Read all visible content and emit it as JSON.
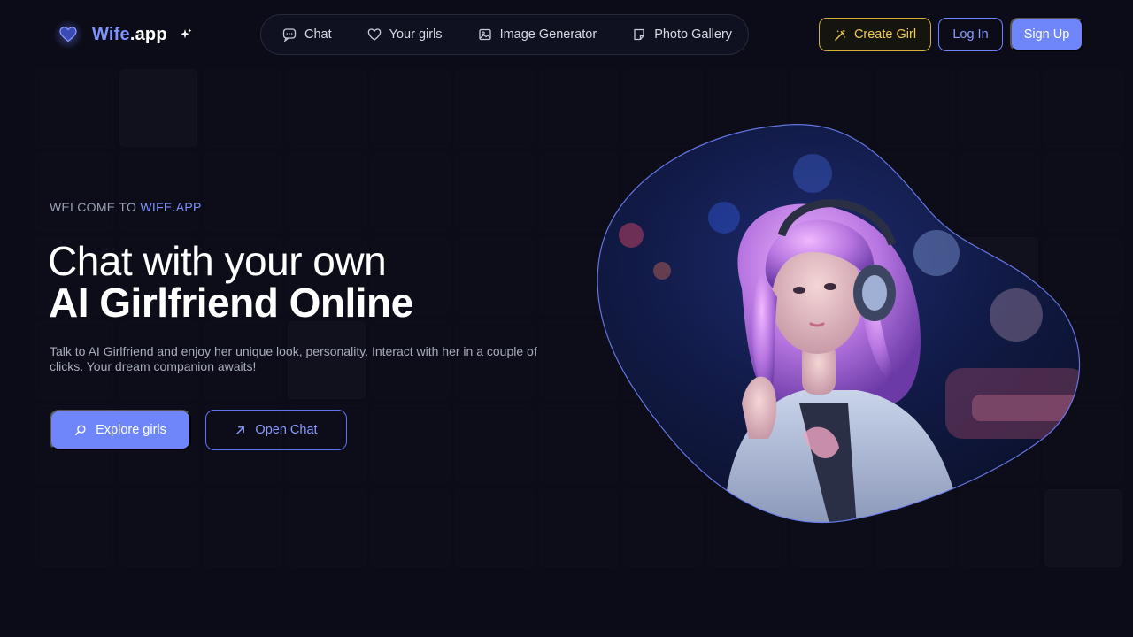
{
  "brand": {
    "name_part1": "Wife",
    "name_part2": ".app",
    "accent_color": "#7f93ff",
    "logo_icon": "heart-icon",
    "sparkle_icon": "sparkle-icon"
  },
  "nav": {
    "items": [
      {
        "label": "Chat",
        "icon": "chat-bubble-icon"
      },
      {
        "label": "Your girls",
        "icon": "heart-outline-icon"
      },
      {
        "label": "Image Generator",
        "icon": "image-icon"
      },
      {
        "label": "Photo Gallery",
        "icon": "gallery-icon"
      }
    ]
  },
  "header_actions": {
    "create_label": "Create Girl",
    "create_icon": "magic-wand-icon",
    "login_label": "Log In",
    "signup_label": "Sign Up",
    "create_color": "#f3cc52",
    "primary_color": "#6f86fb"
  },
  "hero": {
    "welcome_prefix": "WELCOME TO",
    "welcome_brand": "WIFE.APP",
    "headline_light": "Chat with your own",
    "headline_bold": "AI Girlfriend Online",
    "description": "Talk to AI Girlfriend and enjoy her unique look, personality. Interact with her in a couple of clicks. Your dream companion awaits!",
    "explore_label": "Explore girls",
    "explore_icon": "search-icon",
    "open_chat_label": "Open Chat",
    "open_chat_icon": "arrow-up-right-icon",
    "image_subject": "portrait-illustration"
  }
}
